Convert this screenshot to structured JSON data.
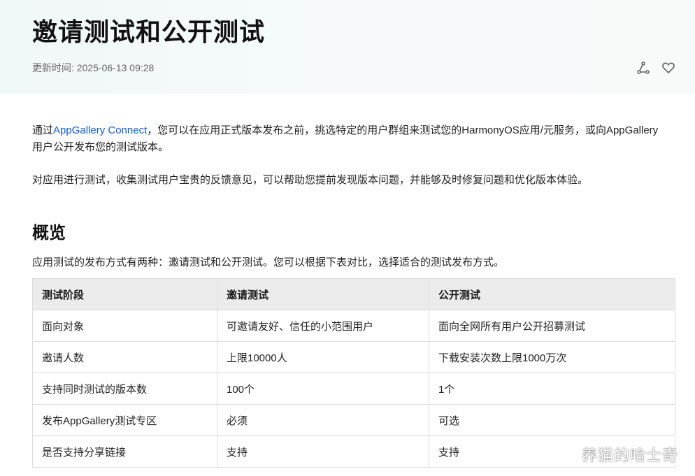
{
  "header": {
    "title": "邀请测试和公开测试",
    "updated": "更新时间: 2025-06-13 09:28",
    "share_icon": "share-icon",
    "favorite_icon": "heart-icon"
  },
  "intro": {
    "p1_prefix": "通过",
    "p1_link": "AppGallery Connect",
    "p1_suffix": "，您可以在应用正式版本发布之前，挑选特定的用户群组来测试您的HarmonyOS应用/元服务，或向AppGallery用户公开发布您的测试版本。",
    "p2": "对应用进行测试，收集测试用户宝贵的反馈意见，可以帮助您提前发现版本问题，并能够及时修复问题和优化版本体验。"
  },
  "overview": {
    "heading": "概览",
    "desc": "应用测试的发布方式有两种：邀请测试和公开测试。您可以根据下表对比，选择适合的测试发布方式。"
  },
  "table": {
    "headers": [
      "测试阶段",
      "邀请测试",
      "公开测试"
    ],
    "rows": [
      [
        "面向对象",
        "可邀请友好、信任的小范围用户",
        "面向全网所有用户公开招募测试"
      ],
      [
        "邀请人数",
        "上限10000人",
        "下载安装次数上限1000万次"
      ],
      [
        "支持同时测试的版本数",
        "100个",
        "1个"
      ],
      [
        "发布AppGallery测试专区",
        "必须",
        "可选"
      ],
      [
        "是否支持分享链接",
        "支持",
        "支持"
      ]
    ]
  },
  "watermark": "养猫的哈士奇",
  "colors": {
    "link": "#0a59f7",
    "header_bg": "#f1f8f8",
    "table_header_bg": "#ebebeb",
    "border": "#dcdcdc"
  }
}
